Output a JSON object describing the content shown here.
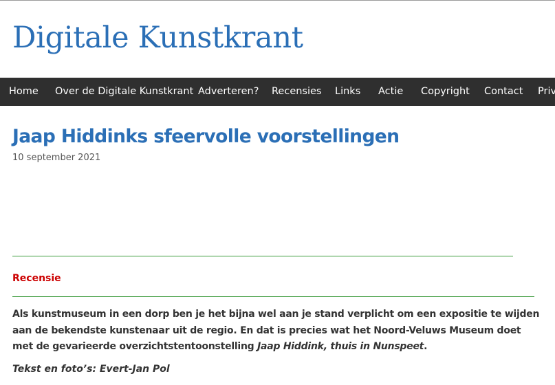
{
  "site": {
    "title": "Digitale Kunstkrant"
  },
  "nav": {
    "items": [
      {
        "label": "Home"
      },
      {
        "label": "Over de Digitale Kunstkrant"
      },
      {
        "label": "Adverteren?"
      },
      {
        "label": "Recensies"
      },
      {
        "label": "Links"
      },
      {
        "label": "Actie"
      },
      {
        "label": "Copyright"
      },
      {
        "label": "Contact"
      },
      {
        "label": "Privacyverklaring"
      }
    ]
  },
  "article": {
    "title": "Jaap Hiddinks sfeervolle voorstellingen",
    "date": "10 september 2021",
    "category": "Recensie",
    "intro_part1": "Als kunstmuseum in een dorp ben je het bijna wel aan je stand verplicht om een expositie te wijden aan de bekendste kunstenaar uit de regio. En dat is precies wat het Noord-Veluws Museum doet met de gevarieerde overzichtstentoonstelling ",
    "intro_italic": "Jaap Hiddink, thuis in Nunspeet",
    "intro_end": ".",
    "credits": "Tekst en foto’s: Evert-Jan Pol"
  },
  "colors": {
    "brand_blue": "#2b6fb6",
    "nav_background": "#2f2f2f",
    "category_red": "#cc0000",
    "rule_green": "#3a9a3a"
  }
}
